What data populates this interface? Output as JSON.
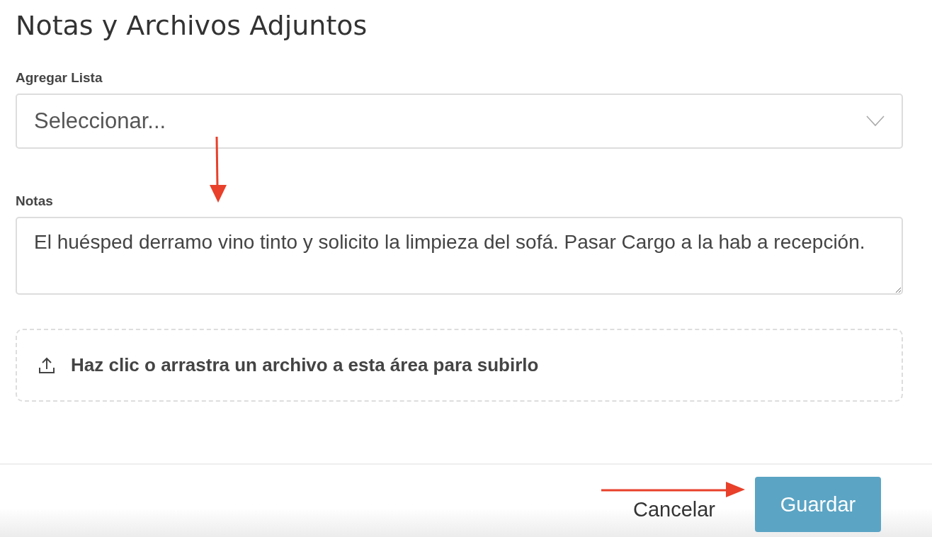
{
  "title": "Notas y Archivos Adjuntos",
  "list_field": {
    "label": "Agregar Lista",
    "placeholder": "Seleccionar..."
  },
  "notes_field": {
    "label": "Notas",
    "value": "El huésped derramo vino tinto y solicito la limpieza del sofá. Pasar Cargo a la hab a recepción."
  },
  "upload": {
    "text": "Haz clic o arrastra un archivo a esta área para subirlo"
  },
  "footer": {
    "buttons": [
      {
        "label": "Cancelar",
        "kind": "link"
      },
      {
        "label": "Guardar",
        "kind": "primary"
      }
    ]
  }
}
